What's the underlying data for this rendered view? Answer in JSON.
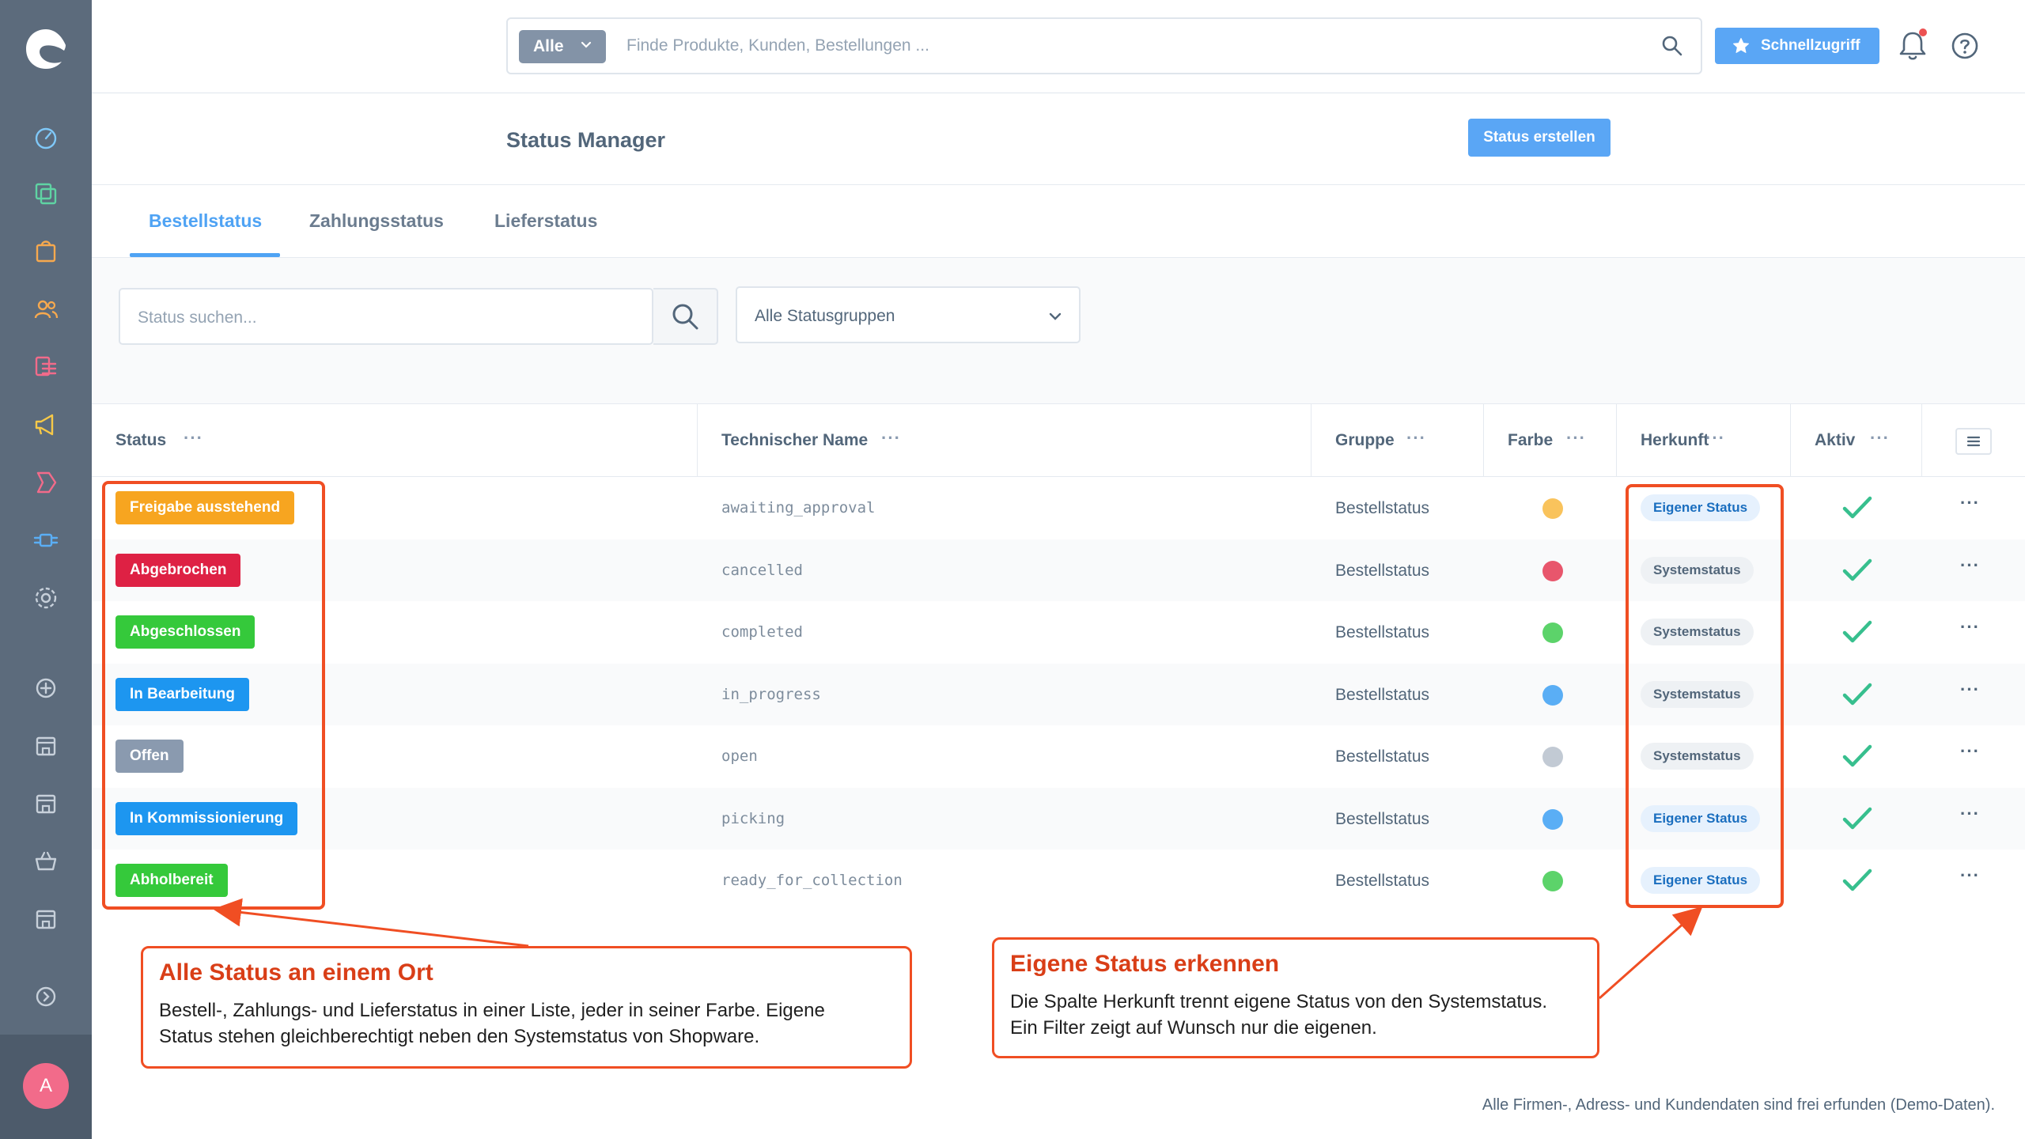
{
  "topbar": {
    "search_type": "Alle",
    "search_placeholder": "Finde Produkte, Kunden, Bestellungen ...",
    "quick_access": "Schnellzugriff"
  },
  "sidebar": {
    "items": [
      "dashboard-icon",
      "catalog-icon",
      "orders-icon",
      "customers-icon",
      "content-icon",
      "marketing-icon",
      "extensions-icon",
      "plugins-icon",
      "settings-icon",
      "add-channel-icon",
      "storefront-icon",
      "storefront-icon",
      "basket-icon",
      "storefront-icon",
      "expand-icon"
    ],
    "avatar_initial": "A"
  },
  "header": {
    "title": "Status Manager",
    "create_button": "Status erstellen"
  },
  "tabs": [
    {
      "label": "Bestellstatus",
      "active": true
    },
    {
      "label": "Zahlungsstatus",
      "active": false
    },
    {
      "label": "Lieferstatus",
      "active": false
    }
  ],
  "filters": {
    "search_placeholder": "Status suchen...",
    "group_select": "Alle Statusgruppen"
  },
  "table": {
    "columns": [
      "Status",
      "Technischer Name",
      "Gruppe",
      "Farbe",
      "Herkunft",
      "Aktiv"
    ],
    "rows": [
      {
        "status": "Freigabe ausstehend",
        "color": "#f7a520",
        "dot": "#f9c35c",
        "technical": "awaiting_approval",
        "group": "Bestellstatus",
        "origin": "Eigener Status",
        "origin_type": "own",
        "active": true
      },
      {
        "status": "Abgebrochen",
        "color": "#de2144",
        "dot": "#e8566c",
        "technical": "cancelled",
        "group": "Bestellstatus",
        "origin": "Systemstatus",
        "origin_type": "sys",
        "active": true
      },
      {
        "status": "Abgeschlossen",
        "color": "#35c93b",
        "dot": "#5cd36a",
        "technical": "completed",
        "group": "Bestellstatus",
        "origin": "Systemstatus",
        "origin_type": "sys",
        "active": true
      },
      {
        "status": "In Bearbeitung",
        "color": "#1d96f0",
        "dot": "#5aaef5",
        "technical": "in_progress",
        "group": "Bestellstatus",
        "origin": "Systemstatus",
        "origin_type": "sys",
        "active": true
      },
      {
        "status": "Offen",
        "color": "#8a9aaf",
        "dot": "#c2cad4",
        "technical": "open",
        "group": "Bestellstatus",
        "origin": "Systemstatus",
        "origin_type": "sys",
        "active": true
      },
      {
        "status": "In Kommissionierung",
        "color": "#1d96f0",
        "dot": "#5aaef5",
        "technical": "picking",
        "group": "Bestellstatus",
        "origin": "Eigener Status",
        "origin_type": "own",
        "active": true
      },
      {
        "status": "Abholbereit",
        "color": "#35c93b",
        "dot": "#5cd36a",
        "technical": "ready_for_collection",
        "group": "Bestellstatus",
        "origin": "Eigener Status",
        "origin_type": "own",
        "active": true
      }
    ]
  },
  "callouts": {
    "left": {
      "title": "Alle Status an einem Ort",
      "line1": "Bestell-, Zahlungs- und Lieferstatus in einer Liste, jeder in seiner Farbe. Eigene",
      "line2": "Status stehen gleichberechtigt neben den Systemstatus von Shopware."
    },
    "right": {
      "title": "Eigene Status erkennen",
      "line1": "Die Spalte Herkunft trennt eigene Status von den Systemstatus.",
      "line2": "Ein Filter zeigt auf Wunsch nur die eigenen."
    }
  },
  "footer": {
    "disclaimer": "Alle Firmen-, Adress- und Kundendaten sind frei erfunden (Demo-Daten)."
  },
  "colors": {
    "accent": "#4fa3f4",
    "annotation": "#f04e23",
    "check": "#37bf8e"
  }
}
